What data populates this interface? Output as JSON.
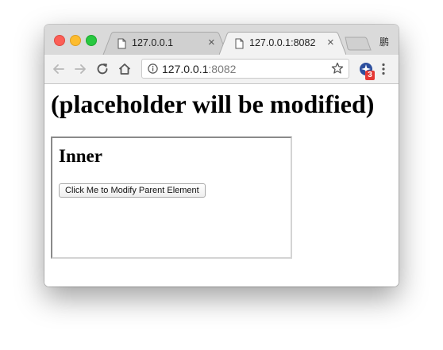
{
  "browser": {
    "tabs": [
      {
        "label": "127.0.0.1",
        "close": "×",
        "active": false
      },
      {
        "label": "127.0.0.1:8082",
        "close": "×",
        "active": true
      }
    ],
    "profile_glyph": "鹏",
    "omnibox": {
      "host": "127.0.0.1",
      "port": ":8082"
    },
    "extension_badge": "3",
    "colors": {
      "tabstrip": "#dadada",
      "toolbar": "#f2f2f2",
      "close_red": "#fc5f57",
      "minimize_yellow": "#fdbc2e",
      "zoom_green": "#28c840",
      "badge_red": "#e53935"
    },
    "icons": [
      "back-arrow-icon",
      "forward-arrow-icon",
      "reload-icon",
      "home-icon",
      "info-icon",
      "star-icon",
      "extension-icon",
      "kebab-menu-icon",
      "page-favicon-icon"
    ]
  },
  "page": {
    "heading": "(placeholder will be modified)",
    "iframe": {
      "heading": "Inner",
      "button_label": "Click Me to Modify Parent Element"
    }
  }
}
